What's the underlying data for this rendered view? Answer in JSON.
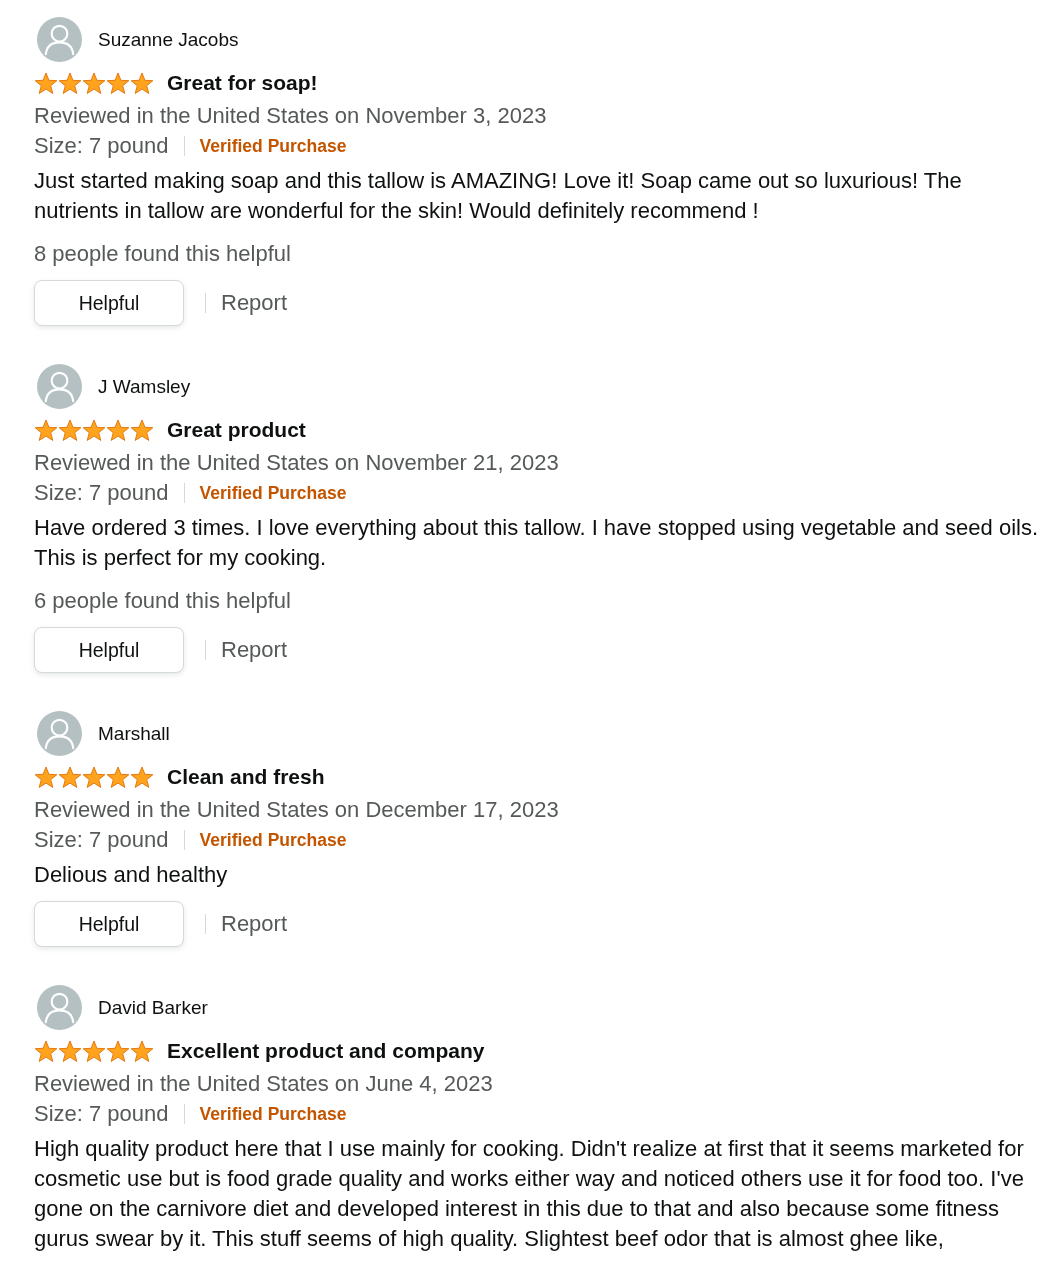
{
  "reviews": [
    {
      "reviewer": "Suzanne Jacobs",
      "stars": 5,
      "title": "Great for soap!",
      "date_line": "Reviewed in the United States on November 3, 2023",
      "size": "Size: 7 pound",
      "verified": "Verified Purchase",
      "body": "Just started making soap and this tallow is AMAZING! Love it! Soap came out so luxurious! The nutrients in tallow are wonderful for the skin! Would definitely recommend !",
      "helpful_count": "8 people found this helpful",
      "helpful_button": "Helpful",
      "report_link": "Report"
    },
    {
      "reviewer": "J Wamsley",
      "stars": 5,
      "title": "Great product",
      "date_line": "Reviewed in the United States on November 21, 2023",
      "size": "Size: 7 pound",
      "verified": "Verified Purchase",
      "body": "Have ordered 3 times. I love everything about this tallow. I have stopped using vegetable and seed oils. This is perfect for my cooking.",
      "helpful_count": "6 people found this helpful",
      "helpful_button": "Helpful",
      "report_link": "Report"
    },
    {
      "reviewer": "Marshall",
      "stars": 5,
      "title": "Clean and fresh",
      "date_line": "Reviewed in the United States on December 17, 2023",
      "size": "Size: 7 pound",
      "verified": "Verified Purchase",
      "body": "Delious and healthy",
      "helpful_button": "Helpful",
      "report_link": "Report"
    },
    {
      "reviewer": "David Barker",
      "stars": 5,
      "title": "Excellent product and company",
      "date_line": "Reviewed in the United States on June 4, 2023",
      "size": "Size: 7 pound",
      "verified": "Verified Purchase",
      "body": "High quality product here that I use mainly for cooking. Didn't realize at first that it seems marketed for cosmetic use but is food grade quality and works either way and noticed others use it for food too. I've gone on the carnivore diet and developed interest in this due to that and also because some fitness gurus swear by it. This stuff seems of high quality. Slightest beef odor that is almost ghee like,"
    }
  ]
}
